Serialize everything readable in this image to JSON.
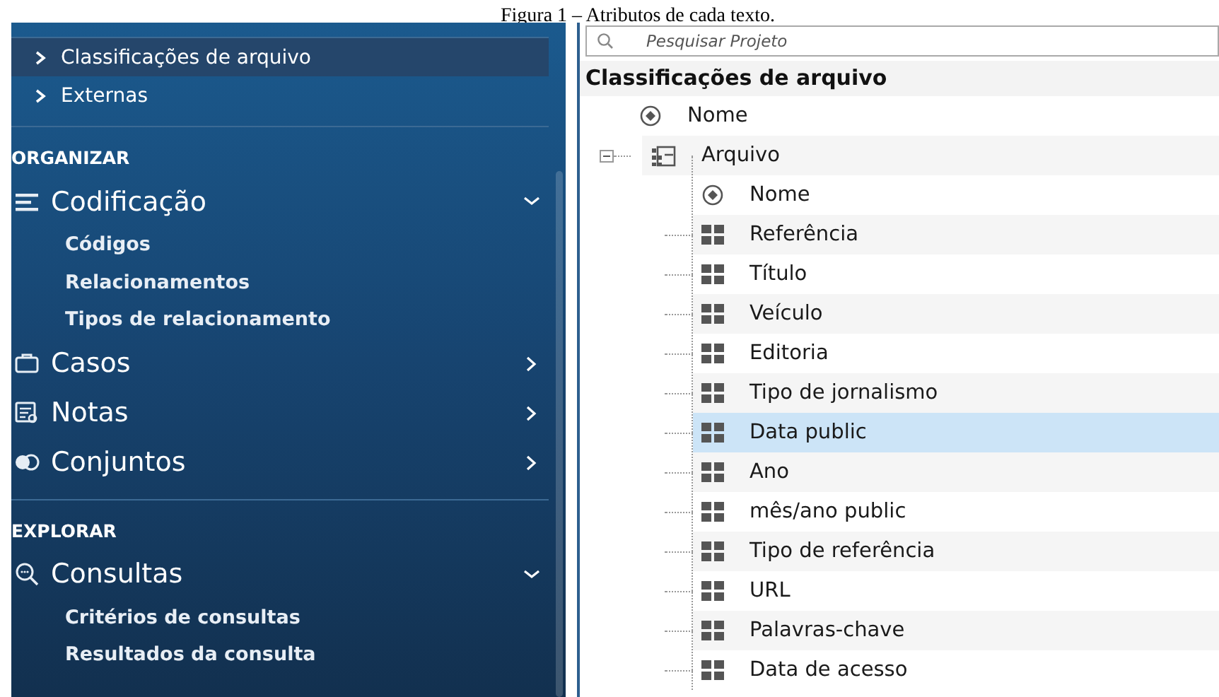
{
  "caption": "Figura 1 – Atributos de cada texto.",
  "sidebar": {
    "items": [
      {
        "kind": "nav",
        "label": "Classificações de arquivo",
        "selected": true
      },
      {
        "kind": "nav",
        "label": "Externas",
        "selected": false
      },
      {
        "kind": "section",
        "label": "ORGANIZAR"
      },
      {
        "kind": "group",
        "label": "Codificação",
        "expanded": true,
        "children": [
          {
            "label": "Códigos"
          },
          {
            "label": "Relacionamentos"
          },
          {
            "label": "Tipos de relacionamento"
          }
        ]
      },
      {
        "kind": "group",
        "label": "Casos",
        "expanded": false
      },
      {
        "kind": "group",
        "label": "Notas",
        "expanded": false
      },
      {
        "kind": "group",
        "label": "Conjuntos",
        "expanded": false
      },
      {
        "kind": "section",
        "label": "EXPLORAR"
      },
      {
        "kind": "group",
        "label": "Consultas",
        "expanded": true,
        "children": [
          {
            "label": "Critérios de consultas"
          },
          {
            "label": "Resultados da consulta"
          }
        ]
      }
    ]
  },
  "search": {
    "placeholder": "Pesquisar Projeto"
  },
  "tree": {
    "title": "Classificações de arquivo",
    "items": [
      {
        "kind": "name",
        "label": "Nome",
        "selected": false
      },
      {
        "kind": "classification",
        "label": "Arquivo",
        "selected": false,
        "expanded": true,
        "children": [
          {
            "kind": "name",
            "label": "Nome",
            "selected": false
          },
          {
            "kind": "attribute",
            "label": "Referência",
            "selected": false
          },
          {
            "kind": "attribute",
            "label": "Título",
            "selected": false
          },
          {
            "kind": "attribute",
            "label": "Veículo",
            "selected": false
          },
          {
            "kind": "attribute",
            "label": "Editoria",
            "selected": false
          },
          {
            "kind": "attribute",
            "label": "Tipo de jornalismo",
            "selected": false
          },
          {
            "kind": "attribute",
            "label": "Data public",
            "selected": true
          },
          {
            "kind": "attribute",
            "label": "Ano",
            "selected": false
          },
          {
            "kind": "attribute",
            "label": "mês/ano public",
            "selected": false
          },
          {
            "kind": "attribute",
            "label": "Tipo de referência",
            "selected": false
          },
          {
            "kind": "attribute",
            "label": "URL",
            "selected": false
          },
          {
            "kind": "attribute",
            "label": "Palavras-chave",
            "selected": false
          },
          {
            "kind": "attribute",
            "label": "Data de acesso",
            "selected": false
          }
        ]
      }
    ]
  }
}
